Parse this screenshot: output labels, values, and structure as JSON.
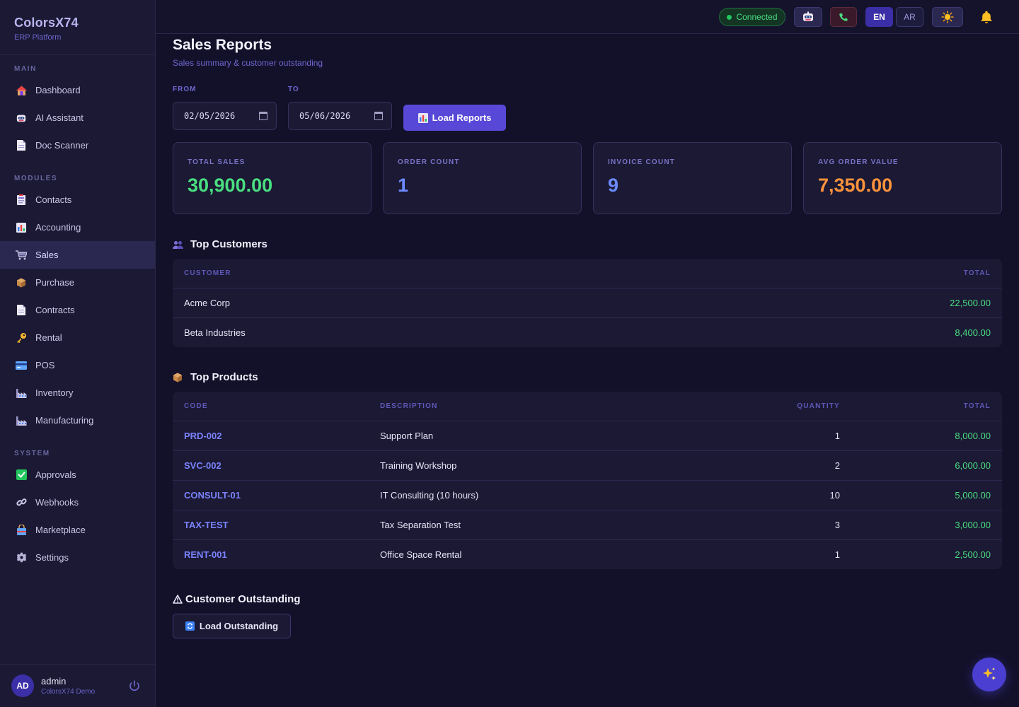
{
  "brand": {
    "name": "ColorsX74",
    "subtitle": "ERP Platform"
  },
  "sidebar": {
    "sections": [
      {
        "label": "MAIN",
        "items": [
          {
            "label": "Dashboard",
            "icon": "house-icon"
          },
          {
            "label": "AI Assistant",
            "icon": "robot-icon"
          },
          {
            "label": "Doc Scanner",
            "icon": "document-icon"
          }
        ]
      },
      {
        "label": "MODULES",
        "items": [
          {
            "label": "Contacts",
            "icon": "contacts-icon"
          },
          {
            "label": "Accounting",
            "icon": "bar-chart-icon"
          },
          {
            "label": "Sales",
            "icon": "cart-icon",
            "active": true
          },
          {
            "label": "Purchase",
            "icon": "package-icon"
          },
          {
            "label": "Contracts",
            "icon": "document-icon"
          },
          {
            "label": "Rental",
            "icon": "key-icon"
          },
          {
            "label": "POS",
            "icon": "credit-card-icon"
          },
          {
            "label": "Inventory",
            "icon": "factory-icon"
          },
          {
            "label": "Manufacturing",
            "icon": "factory-icon"
          }
        ]
      },
      {
        "label": "SYSTEM",
        "items": [
          {
            "label": "Approvals",
            "icon": "check-box-icon"
          },
          {
            "label": "Webhooks",
            "icon": "link-icon"
          },
          {
            "label": "Marketplace",
            "icon": "shopping-bag-icon"
          },
          {
            "label": "Settings",
            "icon": "gear-icon"
          }
        ]
      }
    ]
  },
  "user": {
    "initials": "AD",
    "name": "admin",
    "org": "ColorsX74 Demo"
  },
  "topbar": {
    "status": "Connected",
    "lang_en": "EN",
    "lang_ar": "AR"
  },
  "page": {
    "title": "Sales Reports",
    "subtitle": "Sales summary & customer outstanding"
  },
  "filters": {
    "from_label": "FROM",
    "from_value": "02/05/2026",
    "to_label": "TO",
    "to_value": "05/06/2026",
    "load_label": "Load Reports"
  },
  "stats": [
    {
      "label": "TOTAL SALES",
      "value": "30,900.00",
      "color": "#4ade80"
    },
    {
      "label": "ORDER COUNT",
      "value": "1",
      "color": "#6d8bff"
    },
    {
      "label": "INVOICE COUNT",
      "value": "9",
      "color": "#6d8bff"
    },
    {
      "label": "AVG ORDER VALUE",
      "value": "7,350.00",
      "color": "#fb923c"
    }
  ],
  "top_customers": {
    "title": "Top Customers",
    "headers": {
      "customer": "CUSTOMER",
      "total": "TOTAL"
    },
    "rows": [
      {
        "customer": "Acme Corp",
        "total": "22,500.00"
      },
      {
        "customer": "Beta Industries",
        "total": "8,400.00"
      }
    ]
  },
  "top_products": {
    "title": "Top Products",
    "headers": {
      "code": "CODE",
      "description": "DESCRIPTION",
      "quantity": "QUANTITY",
      "total": "TOTAL"
    },
    "rows": [
      {
        "code": "PRD-002",
        "description": "Support Plan",
        "quantity": "1",
        "total": "8,000.00"
      },
      {
        "code": "SVC-002",
        "description": "Training Workshop",
        "quantity": "2",
        "total": "6,000.00"
      },
      {
        "code": "CONSULT-01",
        "description": "IT Consulting (10 hours)",
        "quantity": "10",
        "total": "5,000.00"
      },
      {
        "code": "TAX-TEST",
        "description": "Tax Separation Test",
        "quantity": "3",
        "total": "3,000.00"
      },
      {
        "code": "RENT-001",
        "description": "Office Space Rental",
        "quantity": "1",
        "total": "2,500.00"
      }
    ]
  },
  "outstanding": {
    "title": "Customer Outstanding",
    "button": "Load Outstanding"
  }
}
